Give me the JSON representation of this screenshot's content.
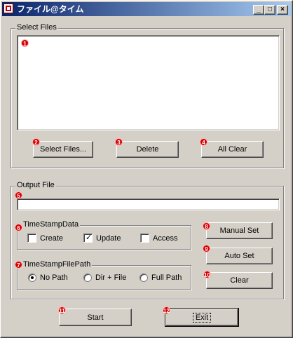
{
  "window": {
    "title": "ファイル@タイム",
    "minimize_glyph": "_",
    "maximize_glyph": "□",
    "close_glyph": "×"
  },
  "select_files": {
    "group_label": "Select Files",
    "file_list": [],
    "buttons": {
      "select": "Select Files...",
      "delete": "Delete",
      "all_clear": "All Clear"
    }
  },
  "output_file": {
    "group_label": "Output File",
    "value": ""
  },
  "timestamp_data": {
    "group_label": "TimeStampData",
    "options": [
      {
        "label": "Create",
        "checked": false
      },
      {
        "label": "Update",
        "checked": true
      },
      {
        "label": "Access",
        "checked": false
      }
    ]
  },
  "timestamp_file_path": {
    "group_label": "TimeStampFilePath",
    "options": [
      {
        "label": "No Path",
        "selected": true
      },
      {
        "label": "Dir + File",
        "selected": false
      },
      {
        "label": "Full Path",
        "selected": false
      }
    ]
  },
  "side_buttons": {
    "manual_set": "Manual Set",
    "auto_set": "Auto Set",
    "clear": "Clear"
  },
  "bottom_buttons": {
    "start": "Start",
    "exit": "Exit"
  },
  "markers": [
    "1",
    "2",
    "3",
    "4",
    "5",
    "6",
    "7",
    "8",
    "9",
    "10",
    "11",
    "12"
  ],
  "colors": {
    "title_start": "#0a246a",
    "title_end": "#a6caf0",
    "face": "#d4d0c8",
    "marker_red": "#d40000"
  }
}
